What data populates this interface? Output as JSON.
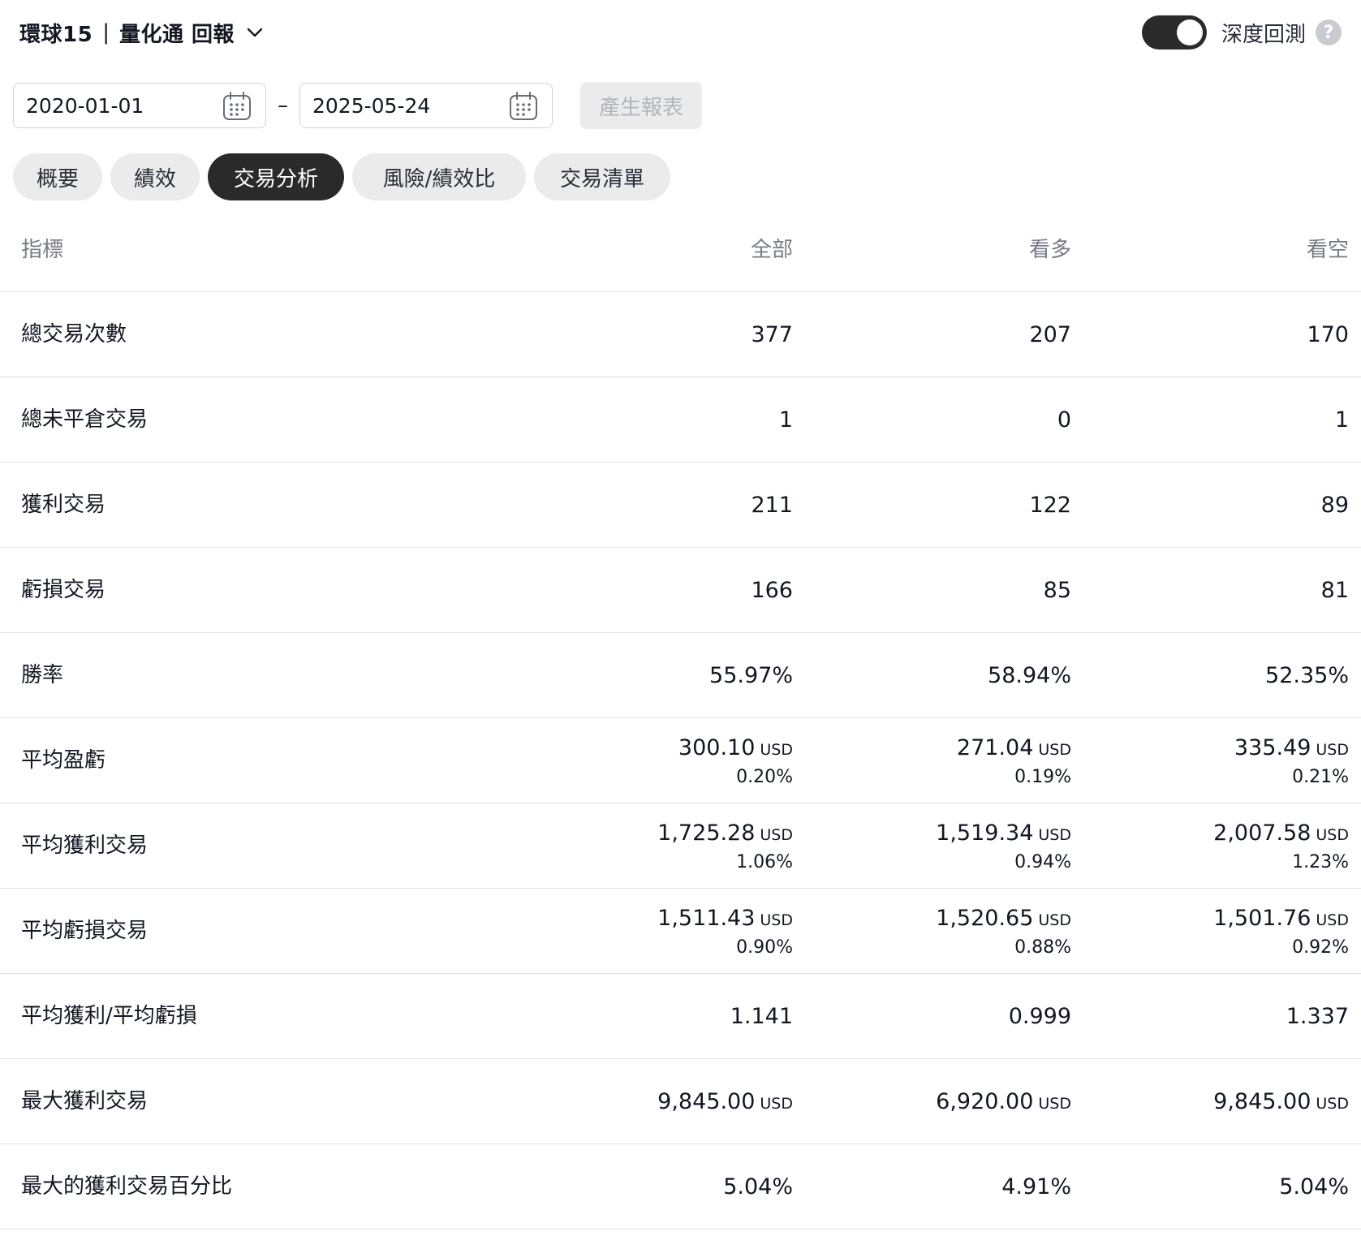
{
  "header": {
    "title_main": "環球15",
    "title_sep": "|",
    "title_sub": "量化通 回報",
    "deep_backtest_label": "深度回測",
    "help_glyph": "?"
  },
  "dates": {
    "start": "2020-01-01",
    "end": "2025-05-24",
    "dash": "–",
    "generate_label": "產生報表"
  },
  "tabs": [
    {
      "label": "概要",
      "active": false
    },
    {
      "label": "績效",
      "active": false
    },
    {
      "label": "交易分析",
      "active": true
    },
    {
      "label": "風險/績效比",
      "active": false
    },
    {
      "label": "交易清單",
      "active": false
    }
  ],
  "table": {
    "headers": {
      "metric": "指標",
      "all": "全部",
      "long": "看多",
      "short": "看空"
    },
    "rows": [
      {
        "label": "總交易次數",
        "all": {
          "v": "377"
        },
        "long": {
          "v": "207"
        },
        "short": {
          "v": "170"
        }
      },
      {
        "label": "總未平倉交易",
        "all": {
          "v": "1"
        },
        "long": {
          "v": "0"
        },
        "short": {
          "v": "1"
        }
      },
      {
        "label": "獲利交易",
        "all": {
          "v": "211"
        },
        "long": {
          "v": "122"
        },
        "short": {
          "v": "89"
        }
      },
      {
        "label": "虧損交易",
        "all": {
          "v": "166"
        },
        "long": {
          "v": "85"
        },
        "short": {
          "v": "81"
        }
      },
      {
        "label": "勝率",
        "all": {
          "v": "55.97%"
        },
        "long": {
          "v": "58.94%"
        },
        "short": {
          "v": "52.35%"
        }
      },
      {
        "label": "平均盈虧",
        "all": {
          "v": "300.10",
          "u": "USD",
          "s": "0.20%"
        },
        "long": {
          "v": "271.04",
          "u": "USD",
          "s": "0.19%"
        },
        "short": {
          "v": "335.49",
          "u": "USD",
          "s": "0.21%"
        }
      },
      {
        "label": "平均獲利交易",
        "all": {
          "v": "1,725.28",
          "u": "USD",
          "s": "1.06%"
        },
        "long": {
          "v": "1,519.34",
          "u": "USD",
          "s": "0.94%"
        },
        "short": {
          "v": "2,007.58",
          "u": "USD",
          "s": "1.23%"
        }
      },
      {
        "label": "平均虧損交易",
        "all": {
          "v": "1,511.43",
          "u": "USD",
          "s": "0.90%"
        },
        "long": {
          "v": "1,520.65",
          "u": "USD",
          "s": "0.88%"
        },
        "short": {
          "v": "1,501.76",
          "u": "USD",
          "s": "0.92%"
        }
      },
      {
        "label": "平均獲利/平均虧損",
        "all": {
          "v": "1.141"
        },
        "long": {
          "v": "0.999"
        },
        "short": {
          "v": "1.337"
        }
      },
      {
        "label": "最大獲利交易",
        "all": {
          "v": "9,845.00",
          "u": "USD"
        },
        "long": {
          "v": "6,920.00",
          "u": "USD"
        },
        "short": {
          "v": "9,845.00",
          "u": "USD"
        }
      },
      {
        "label": "最大的獲利交易百分比",
        "all": {
          "v": "5.04%"
        },
        "long": {
          "v": "4.91%"
        },
        "short": {
          "v": "5.04%"
        }
      }
    ]
  }
}
